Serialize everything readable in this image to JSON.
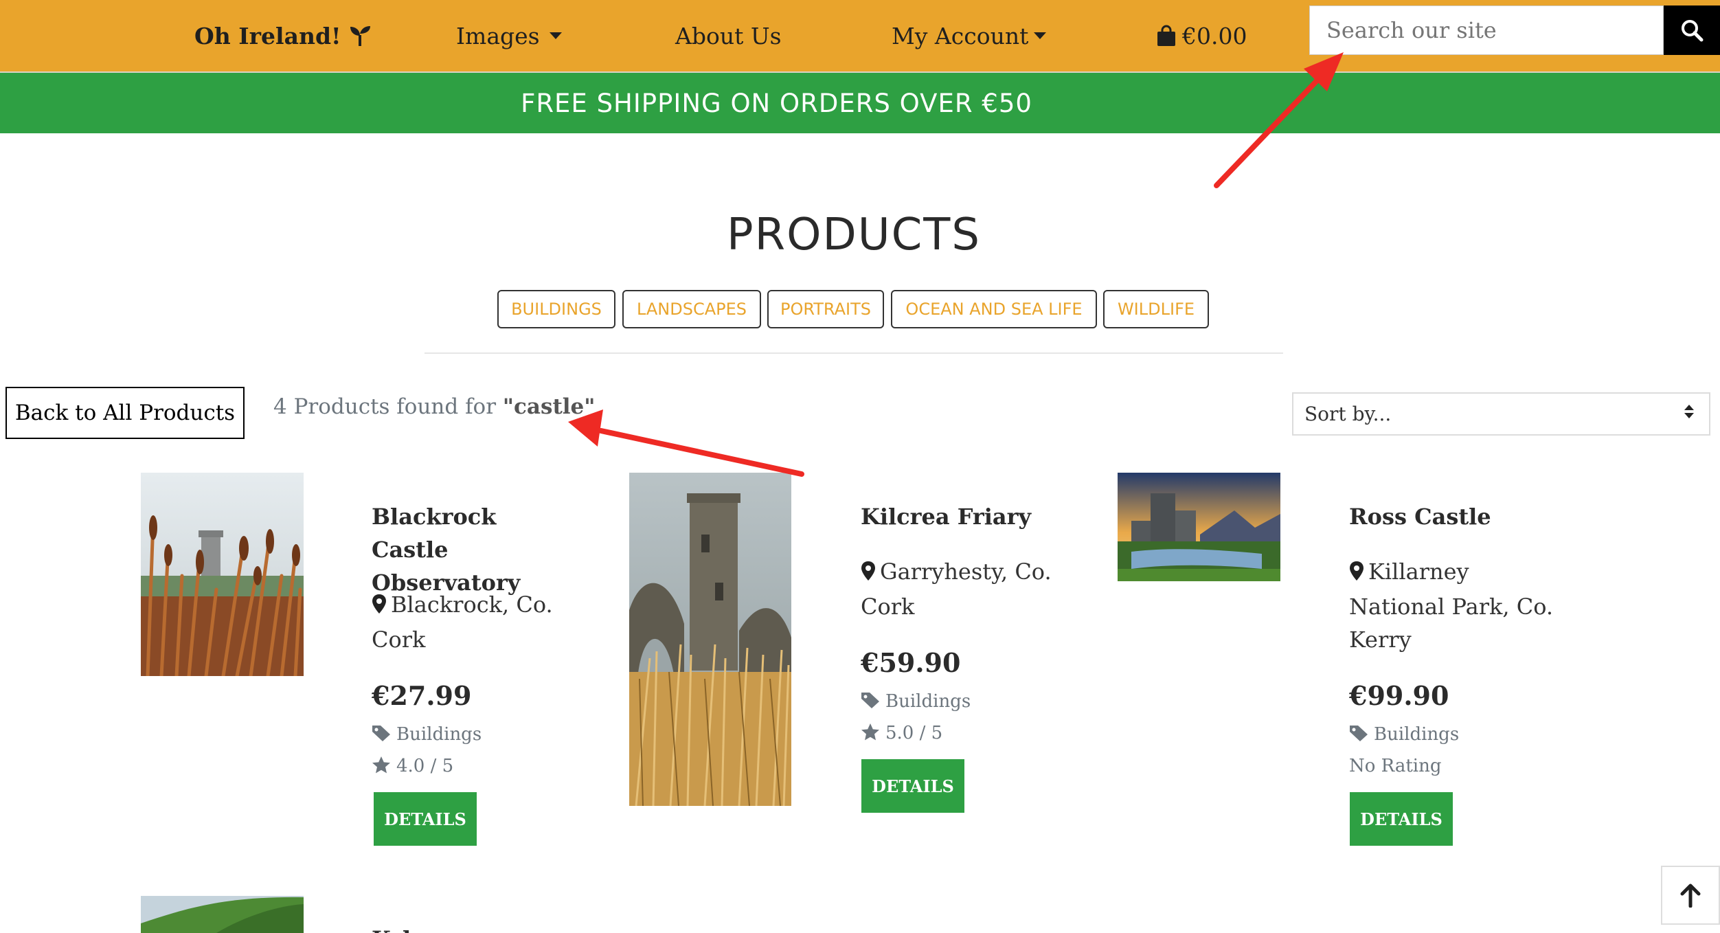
{
  "nav": {
    "brand": "Oh Ireland!",
    "images_label": "Images",
    "about_label": "About Us",
    "account_label": "My Account",
    "cart_total": "€0.00",
    "search_placeholder": "Search our site"
  },
  "banner": {
    "text": "FREE SHIPPING ON ORDERS OVER €50"
  },
  "page": {
    "title": "PRODUCTS",
    "categories": [
      "BUILDINGS",
      "LANDSCAPES",
      "PORTRAITS",
      "OCEAN AND SEA LIFE",
      "WILDLIFE"
    ],
    "back_label": "Back to All Products",
    "results_prefix": "4 Products found for ",
    "results_query": "\"castle\"",
    "sort_label": "Sort by..."
  },
  "products": [
    {
      "name": "Blackrock Castle Observatory",
      "location": "Blackrock, Co. Cork",
      "price": "€27.99",
      "category": "Buildings",
      "rating": "4.0 / 5",
      "details_label": "DETAILS"
    },
    {
      "name": "Kilcrea Friary",
      "location": "Garryhesty, Co. Cork",
      "price": "€59.90",
      "category": "Buildings",
      "rating": "5.0 / 5",
      "details_label": "DETAILS"
    },
    {
      "name": "Ross Castle",
      "location": "Killarney National Park, Co. Kerry",
      "price": "€99.90",
      "category": "Buildings",
      "rating": "No Rating",
      "details_label": "DETAILS"
    },
    {
      "name": "Kylemore Abbey"
    }
  ],
  "colors": {
    "nav_bg": "#e9a42c",
    "banner_bg": "#2ea043",
    "accent_text": "#e9a42c",
    "button_green": "#2ea043",
    "annotation_arrow": "#ee2a24"
  },
  "icons": [
    "seedling-icon",
    "caret-down-icon",
    "shopping-bag-icon",
    "search-icon",
    "map-pin-icon",
    "tag-icon",
    "star-icon",
    "arrow-up-icon"
  ]
}
